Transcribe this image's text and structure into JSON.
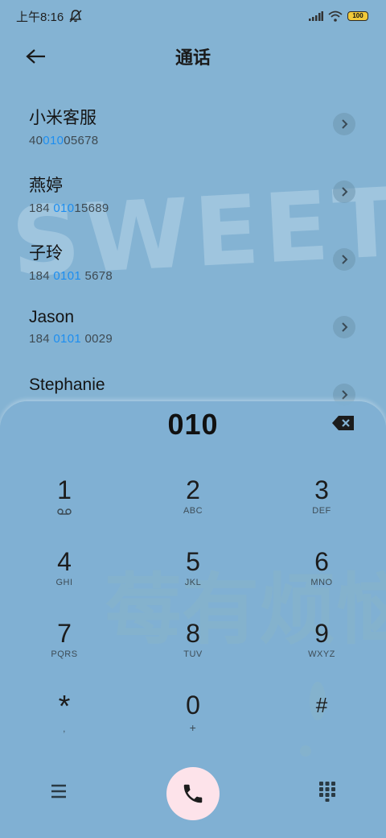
{
  "status": {
    "time": "上午8:16"
  },
  "header": {
    "title": "通话"
  },
  "contacts": [
    {
      "name": "小米客服",
      "num_pre": "40",
      "num_hl": "010",
      "num_post": "05678"
    },
    {
      "name": "燕婷",
      "num_pre": "184 ",
      "num_hl": "010",
      "num_post": "15689"
    },
    {
      "name": "子玲",
      "num_pre": "184 ",
      "num_hl": "0101",
      "num_post": " 5678"
    },
    {
      "name": "Jason",
      "num_pre": "184 ",
      "num_hl": "0101",
      "num_post": " 0029"
    },
    {
      "name": "Stephanie",
      "num_pre": "",
      "num_hl": "",
      "num_post": ""
    }
  ],
  "dialer": {
    "display": "010",
    "keys": [
      {
        "digit": "1",
        "letters": ""
      },
      {
        "digit": "2",
        "letters": "ABC"
      },
      {
        "digit": "3",
        "letters": "DEF"
      },
      {
        "digit": "4",
        "letters": "GHI"
      },
      {
        "digit": "5",
        "letters": "JKL"
      },
      {
        "digit": "6",
        "letters": "MNO"
      },
      {
        "digit": "7",
        "letters": "PQRS"
      },
      {
        "digit": "8",
        "letters": "TUV"
      },
      {
        "digit": "9",
        "letters": "WXYZ"
      },
      {
        "digit": "*",
        "letters": ","
      },
      {
        "digit": "0",
        "letters": "+"
      },
      {
        "digit": "#",
        "letters": ""
      }
    ]
  },
  "colors": {
    "background": "#84b3d3",
    "highlight": "#1d8ef0",
    "call_button": "#fde3ea"
  },
  "wallpaper": {
    "text_top": "SWEET",
    "text_bottom": "莓有烦恼"
  }
}
